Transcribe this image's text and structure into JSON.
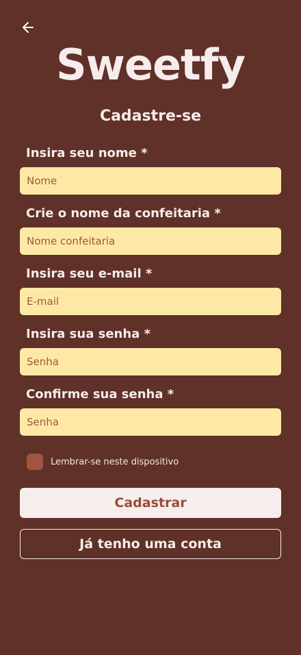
{
  "header": {
    "back_icon": "arrow-left-icon",
    "brand": "Sweetfy",
    "subtitle": "Cadastre-se"
  },
  "form": {
    "name": {
      "label": "Insira seu nome *",
      "placeholder": "Nome",
      "value": ""
    },
    "bakery": {
      "label": "Crie o nome da confeitaria *",
      "placeholder": "Nome confeitaria",
      "value": ""
    },
    "email": {
      "label": "Insira seu e-mail *",
      "placeholder": "E-mail",
      "value": ""
    },
    "password": {
      "label": "Insira sua senha *",
      "placeholder": "Senha",
      "value": ""
    },
    "confirm_password": {
      "label": "Confirme sua senha *",
      "placeholder": "Senha",
      "value": ""
    },
    "remember": {
      "label": "Lembrar-se neste dispositivo",
      "checked": false
    }
  },
  "actions": {
    "register_label": "Cadastrar",
    "login_label": "Já tenho uma conta"
  },
  "colors": {
    "background": "#5f3128",
    "input_background": "#fde9a5",
    "accent": "#a15440",
    "text_light": "#f6eceb"
  }
}
